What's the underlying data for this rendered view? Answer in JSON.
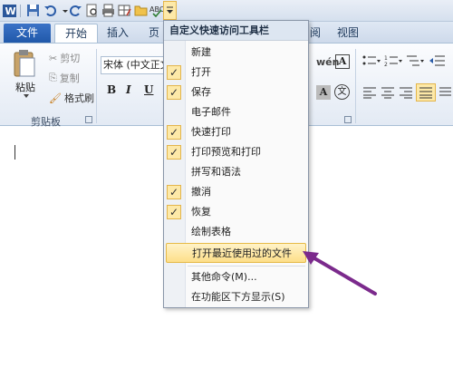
{
  "tabs": {
    "file": "文件",
    "home": "开始",
    "insert": "插入",
    "page": "页",
    "review_partial": "阅",
    "view": "视图"
  },
  "clipboard": {
    "paste": "粘贴",
    "cut": "剪切",
    "copy": "复制",
    "format_painter": "格式刷",
    "group_label": "剪贴板"
  },
  "font": {
    "name": "宋体 (中文正文",
    "bold": "B",
    "italic": "I",
    "underline": "U",
    "char_border": "A",
    "wen": "文"
  },
  "menu": {
    "title": "自定义快速访问工具栏",
    "items": [
      {
        "label": "新建",
        "checked": false
      },
      {
        "label": "打开",
        "checked": true
      },
      {
        "label": "保存",
        "checked": true
      },
      {
        "label": "电子邮件",
        "checked": false
      },
      {
        "label": "快速打印",
        "checked": true
      },
      {
        "label": "打印预览和打印",
        "checked": true
      },
      {
        "label": "拼写和语法",
        "checked": false
      },
      {
        "label": "撤消",
        "checked": true
      },
      {
        "label": "恢复",
        "checked": true
      },
      {
        "label": "绘制表格",
        "checked": false
      },
      {
        "label": "打开最近使用过的文件",
        "checked": false,
        "highlighted": true
      }
    ],
    "more_commands": "其他命令(M)...",
    "show_below": "在功能区下方显示(S)"
  },
  "colors": {
    "accent": "#2b579a",
    "highlight": "#fddf89",
    "arrow": "#7b2a8c"
  }
}
